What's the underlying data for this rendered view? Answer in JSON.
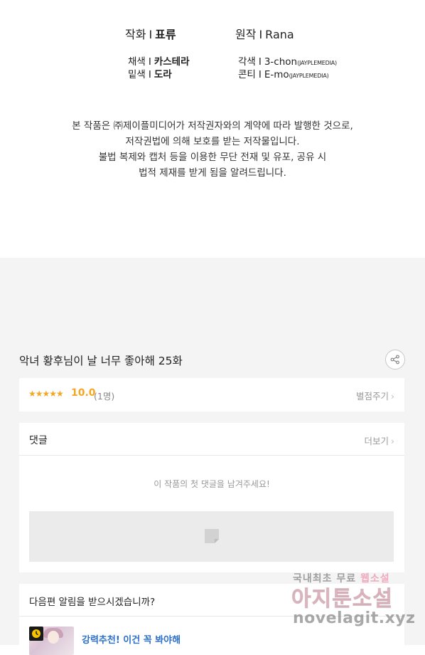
{
  "credits": {
    "art_role": "작화",
    "art_name": "표류",
    "original_role": "원작",
    "original_name": "Rana",
    "color_role": "채색",
    "color_name": "카스테라",
    "adapt_role": "각색",
    "adapt_name": "3-chon",
    "adapt_sub": "(JAYPLEMEDIA)",
    "line_role": "밑색",
    "line_name": "도라",
    "storyboard_role": "콘티",
    "storyboard_name": "E-mo",
    "storyboard_sub": "(JAYPLEMEDIA)",
    "separator": "I"
  },
  "notice": {
    "line1": "본 작품은 ㈜제이플미디어가 저작권자와의 계약에 따라 발행한 것으로,",
    "line2": "저작권법에 의해 보호를 받는 저작물입니다.",
    "line3": "불법 복제와 캡처 등을 이용한 무단 전재 및 유포, 공유 시",
    "line4": "법적 제재를 받게 됨을 알려드립니다."
  },
  "episode": {
    "title": "악녀 황후님이 날 너무 좋아해 25화"
  },
  "rating": {
    "stars": "★★★★★",
    "score": "10.0",
    "count": "(1명)",
    "rate_label": "별점주기",
    "chevron": "›"
  },
  "comments": {
    "title": "댓글",
    "more_label": "더보기",
    "empty_message": "이 작품의 첫 댓글을 남겨주세요!"
  },
  "notify": {
    "question": "다음편 알림을 받으시겠습니까?",
    "recommend_text": "강력추천! 이건 꼭 봐야해"
  },
  "watermark": {
    "top_text_a": "국내최초 무료 ",
    "top_text_b": "웹소설",
    "main_text": "아지툰소설",
    "url": "novelagit.xyz"
  },
  "colors": {
    "accent_star": "#f5a623",
    "link_blue": "#2a6fc9",
    "background_gray": "#f4f4f4"
  },
  "icons": {
    "share": "share-icon",
    "chevron": "chevron-right-icon",
    "input_placeholder": "comment-input-icon",
    "clock": "clock-icon"
  }
}
